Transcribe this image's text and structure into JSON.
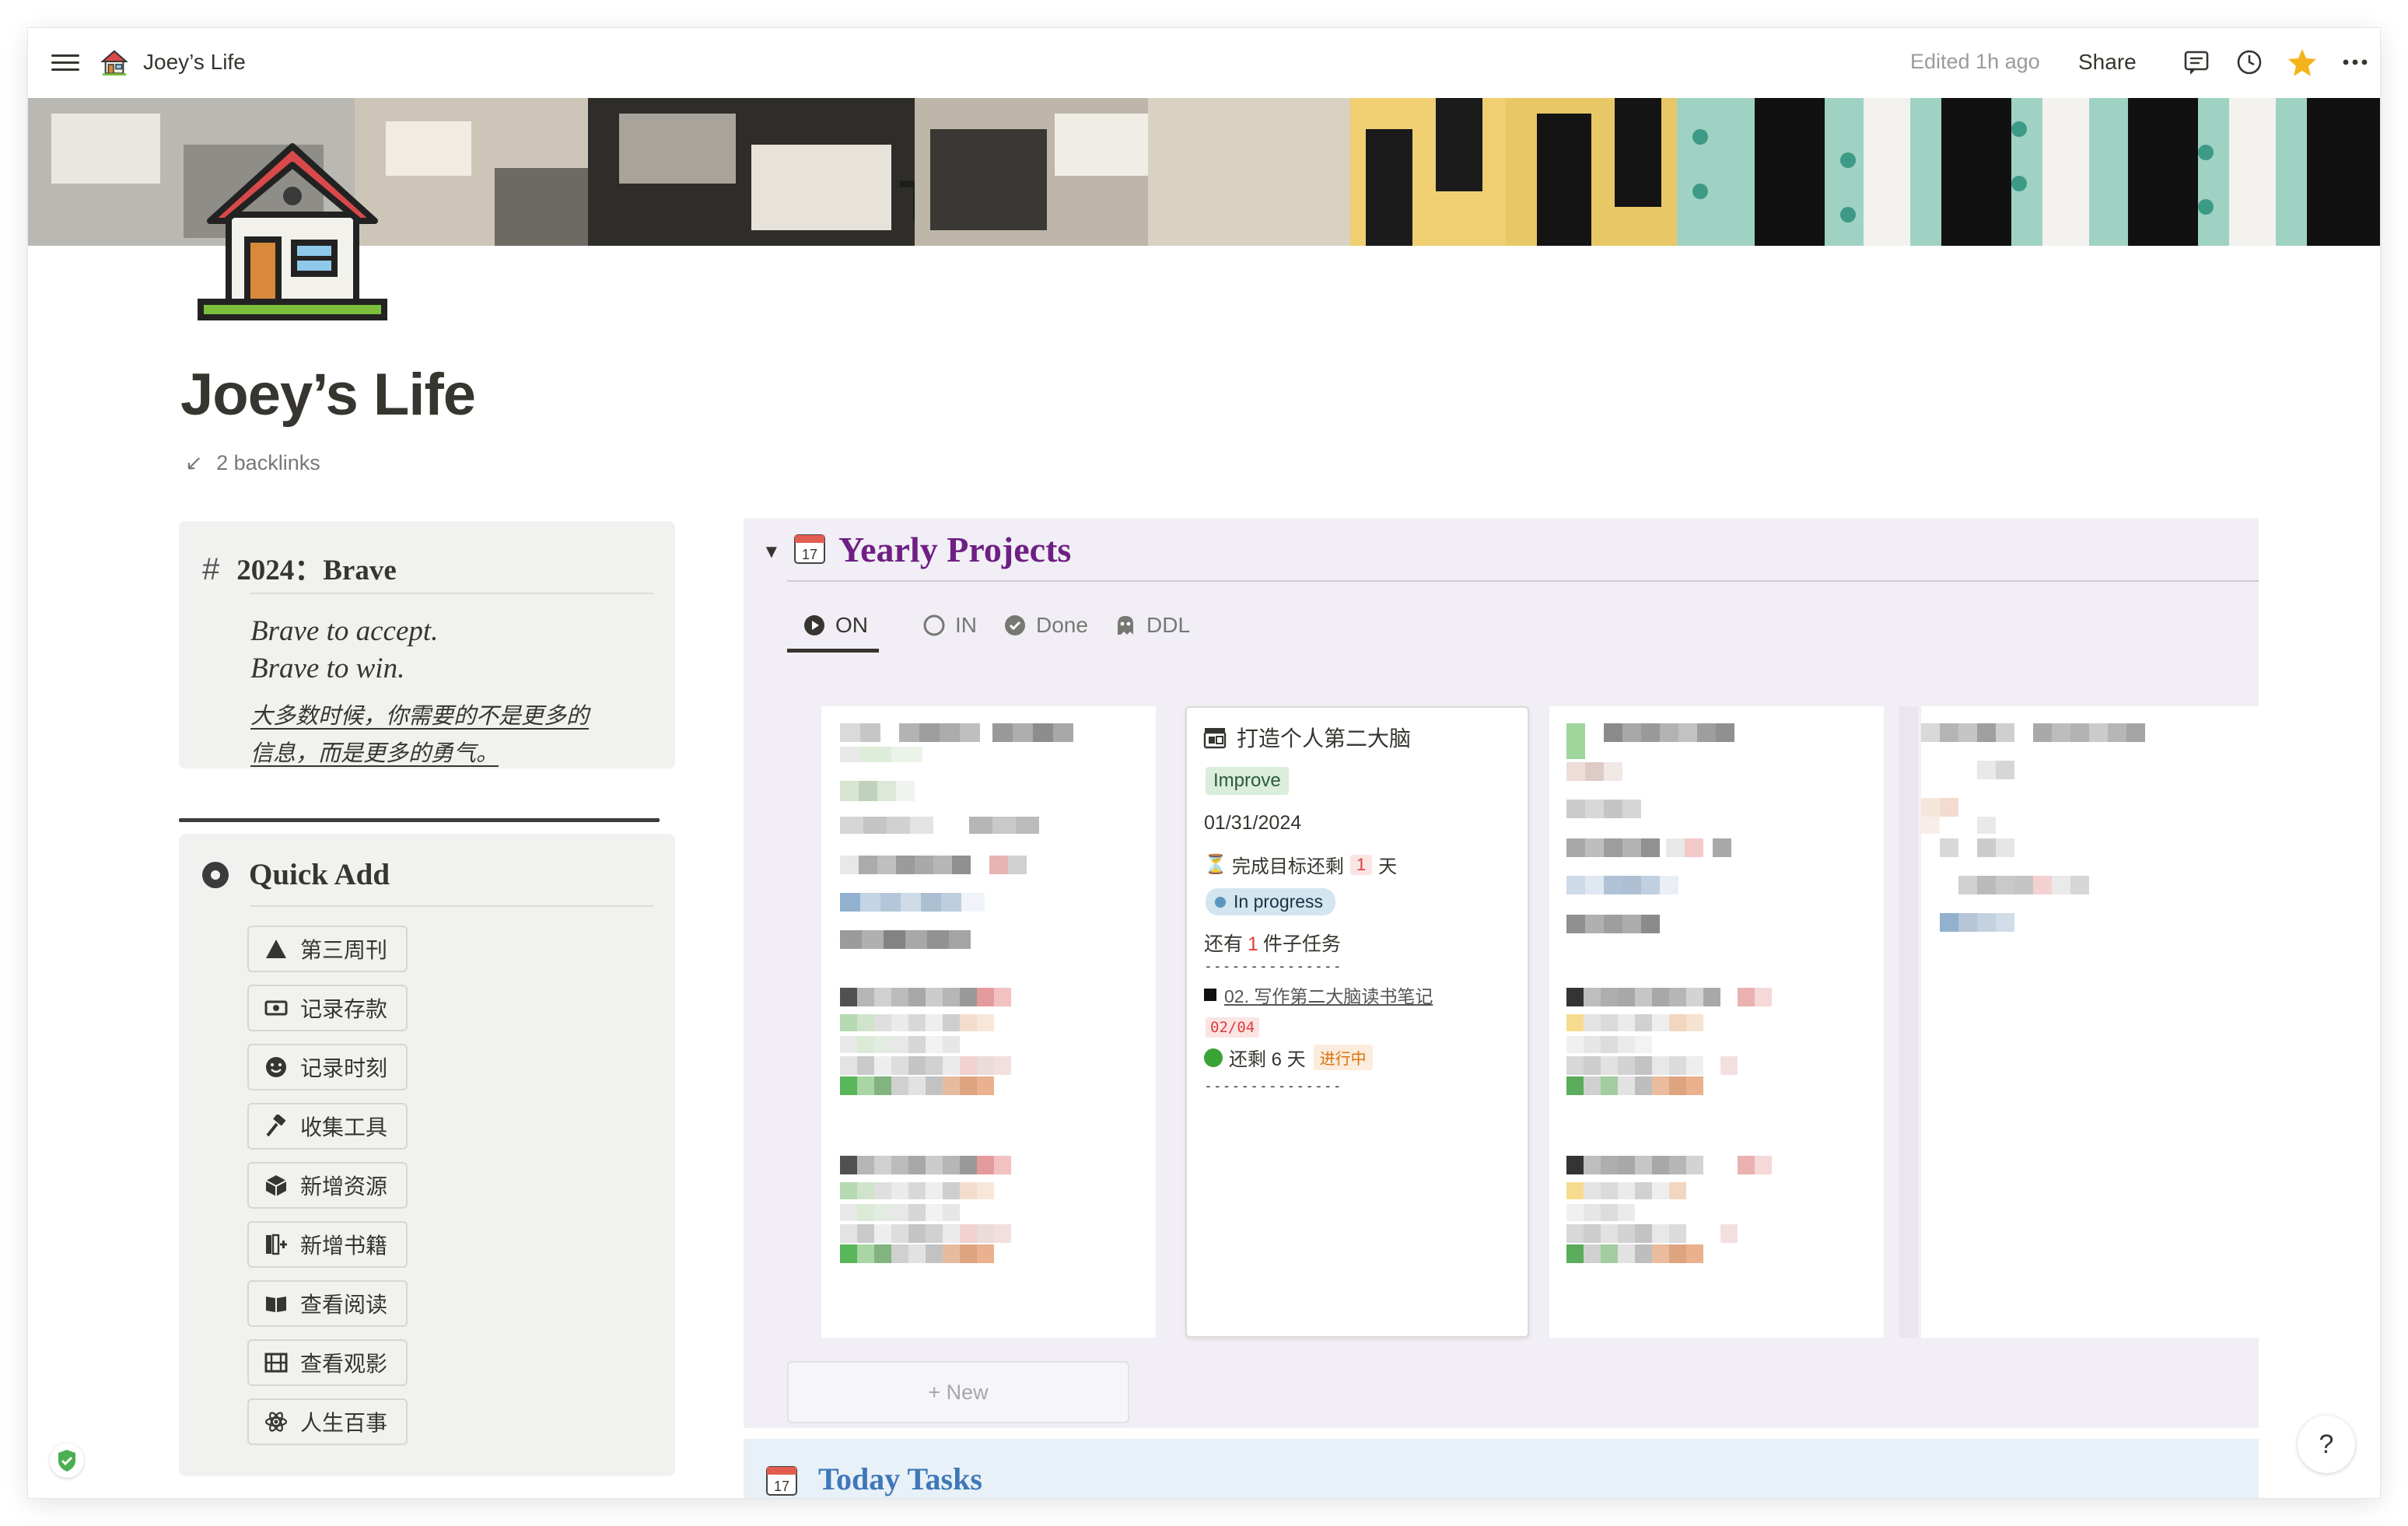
{
  "topbar": {
    "breadcrumb": "Joey’s Life",
    "edited": "Edited 1h ago",
    "share": "Share",
    "icons": [
      "menu-icon",
      "house-icon",
      "comment-icon",
      "clock-icon",
      "star-icon",
      "more-icon"
    ],
    "star_color": "#f5b31b"
  },
  "page": {
    "title": "Joey’s Life",
    "backlinks": "2 backlinks",
    "backlinks_icon": "↙"
  },
  "motto": {
    "heading": "2024：Brave",
    "lines": [
      "Brave to accept.",
      "Brave to win."
    ],
    "chinese": [
      "大多数时候，你需要的不是更多的",
      "信息，而是更多的勇气。"
    ]
  },
  "quick_add": {
    "heading": "Quick Add",
    "buttons": [
      {
        "label": "第三周刊",
        "icon": "triangle-icon"
      },
      {
        "label": "记录存款",
        "icon": "money-icon"
      },
      {
        "label": "记录时刻",
        "icon": "smiley-icon"
      },
      {
        "label": "收集工具",
        "icon": "hammer-icon"
      },
      {
        "label": "新增资源",
        "icon": "box-icon"
      },
      {
        "label": "新增书籍",
        "icon": "book-add-icon"
      },
      {
        "label": "查看阅读",
        "icon": "open-book-icon"
      },
      {
        "label": "查看观影",
        "icon": "film-icon"
      },
      {
        "label": "人生百事",
        "icon": "atom-icon"
      }
    ]
  },
  "yearly": {
    "title": "Yearly Projects",
    "calendar_day": "17",
    "title_color": "#6f1f83",
    "tabs": [
      {
        "label": "ON",
        "icon": "play-circle-icon",
        "active": true
      },
      {
        "label": "IN",
        "icon": "empty-circle-icon",
        "active": false
      },
      {
        "label": "Done",
        "icon": "check-circle-icon",
        "active": false
      },
      {
        "label": "DDL",
        "icon": "ghost-icon",
        "active": false
      }
    ],
    "card": {
      "title": "打造个人第二大脑",
      "tag": "Improve",
      "date": "01/31/2024",
      "remain_prefix": "完成目标还剩",
      "remain_num": "1",
      "remain_suffix": "天",
      "status": "In progress",
      "subtasks_prefix": "还有",
      "subtasks_num": "1",
      "subtasks_suffix": "件子任务",
      "separator": "---------------",
      "task": "02. 写作第二大脑读书笔记",
      "task_date": "02/04",
      "left_text": "还剩 6 天",
      "left_badge": "进行中"
    },
    "new_label": "+ New"
  },
  "today": {
    "title": "Today Tasks",
    "calendar_day": "17",
    "title_color": "#3f77b9"
  },
  "help": "?"
}
